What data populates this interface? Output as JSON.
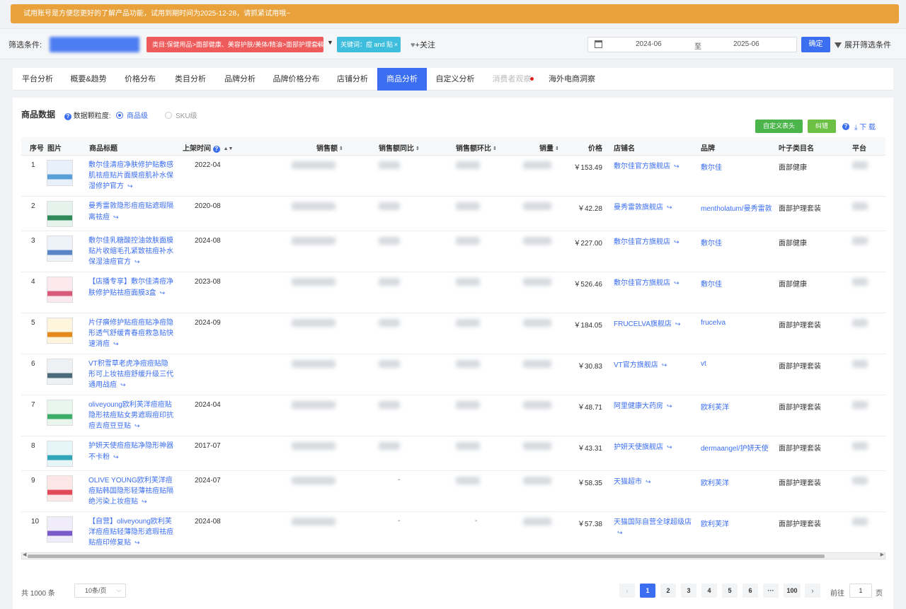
{
  "notice": "试用账号是方便您更好的了解产品功能，试用到期时间为2025-12-28，请抓紧试用哦~",
  "filter": {
    "label": "筛选条件:",
    "category_tag": "类目:保健用品>面部健康、美容护肤/美体/精油>面部护理套装",
    "keyword_tag": "关键词：痘 and 贴",
    "tag_close": "×",
    "follow": "+关注",
    "date_start": "2024-06",
    "date_to": "至",
    "date_end": "2025-06",
    "confirm": "确定",
    "expand": "展开筛选条件"
  },
  "tabs": [
    {
      "label": "平台分析",
      "state": "normal"
    },
    {
      "label": "概要&趋势",
      "state": "normal"
    },
    {
      "label": "价格分布",
      "state": "normal"
    },
    {
      "label": "类目分析",
      "state": "normal"
    },
    {
      "label": "品牌分析",
      "state": "normal"
    },
    {
      "label": "品牌价格分布",
      "state": "normal"
    },
    {
      "label": "店铺分析",
      "state": "normal"
    },
    {
      "label": "商品分析",
      "state": "active"
    },
    {
      "label": "自定义分析",
      "state": "normal"
    },
    {
      "label": "消费者观察",
      "state": "disabled"
    },
    {
      "label": "海外电商洞察",
      "state": "normal"
    }
  ],
  "panel": {
    "title": "商品数据",
    "granularity_label": "数据颗粒度:",
    "option_product": "商品级",
    "option_sku": "SKU级",
    "btn_custom_header": "自定义表头",
    "btn_fix": "纠错",
    "download": "下 载"
  },
  "table": {
    "headers": {
      "idx": "序号",
      "img": "图片",
      "title": "商品标题",
      "date": "上架时间",
      "sales": "销售额",
      "yoy": "销售额同比",
      "mom": "销售额环比",
      "volume": "销量",
      "price": "价格",
      "shop": "店铺名",
      "brand": "品牌",
      "category": "叶子类目名",
      "platform": "平台"
    },
    "rows": [
      {
        "idx": "1",
        "title": "敷尔佳清痘净肤修护贴敷感肌祛痘贴片面膜痘肌补水保湿修护官方",
        "date": "2022-04",
        "price": "￥153.49",
        "shop": "敷尔佳官方旗舰店",
        "brand": "敷尔佳",
        "category": "面部健康",
        "yoy": "",
        "mom": ""
      },
      {
        "idx": "2",
        "title": "曼秀雷敦隐形痘痘贴遮瑕隔离祛痘",
        "date": "2020-08",
        "price": "￥42.28",
        "shop": "曼秀雷敦旗舰店",
        "brand": "mentholatum/曼秀雷敦",
        "category": "面部护理套装",
        "yoy": "",
        "mom": ""
      },
      {
        "idx": "3",
        "title": "敷尔佳乳糖酸控油敛肤面膜贴片收缩毛孔紧致祛痘补水保湿油痘官方",
        "date": "2024-08",
        "price": "￥227.00",
        "shop": "敷尔佳官方旗舰店",
        "brand": "敷尔佳",
        "category": "面部健康",
        "yoy": "",
        "mom": ""
      },
      {
        "idx": "4",
        "title": "【店播专享】敷尔佳清痘净肤修护贴祛痘面膜3盒",
        "date": "2023-08",
        "price": "￥526.46",
        "shop": "敷尔佳官方旗舰店",
        "brand": "敷尔佳",
        "category": "面部健康",
        "yoy": "",
        "mom": ""
      },
      {
        "idx": "5",
        "title": "片仔癀修护贴痘痘贴净痘隐形透气舒缓青春痘救急贴快速消痘",
        "date": "2024-09",
        "price": "￥184.05",
        "shop": "FRUCELVA旗舰店",
        "brand": "frucelva",
        "category": "面部护理套装",
        "yoy": "",
        "mom": ""
      },
      {
        "idx": "6",
        "title": "VT积雪草老虎净痘痘贴隐形可上妆祛痘舒缓升级三代通用战痘",
        "date": "",
        "price": "￥30.83",
        "shop": "VT官方旗舰店",
        "brand": "vt",
        "category": "面部护理套装",
        "yoy": "",
        "mom": ""
      },
      {
        "idx": "7",
        "title": "oliveyoung欧利芙洋痘痘贴隐形祛痘贴女男遮瑕痘印抗痘去痘豆豆贴",
        "date": "2024-04",
        "price": "￥48.71",
        "shop": "阿里健康大药房",
        "brand": "欧利芙洋",
        "category": "面部护理套装",
        "yoy": "",
        "mom": ""
      },
      {
        "idx": "8",
        "title": "护妍天使痘痘贴净隐形神器不卡粉",
        "date": "2017-07",
        "price": "￥43.31",
        "shop": "护妍天使旗舰店",
        "brand": "dermaangel/护妍天使",
        "category": "面部护理套装",
        "yoy": "",
        "mom": ""
      },
      {
        "idx": "9",
        "title": "OLIVE YOUNG欧利芙洋痘痘贴韩国隐形轻薄祛痘贴隔绝污染上妆痘贴",
        "date": "2024-07",
        "price": "￥58.35",
        "shop": "天猫超市",
        "brand": "欧利芙洋",
        "category": "面部护理套装",
        "yoy": "-",
        "mom": ""
      },
      {
        "idx": "10",
        "title": "【自营】oliveyoung欧利芙洋痘痘贴轻薄隐形遮瑕祛痘贴痘印修复贴",
        "date": "2024-08",
        "price": "￥57.38",
        "shop": "天猫国际自营全球超级店",
        "brand": "欧利芙洋",
        "category": "面部护理套装",
        "yoy": "-",
        "mom": "-"
      }
    ]
  },
  "pagination": {
    "total": "共 1000 条",
    "page_size": "10条/页",
    "pages": [
      "1",
      "2",
      "3",
      "4",
      "5",
      "6",
      "···",
      "100"
    ],
    "current": "1",
    "goto_prefix": "前往",
    "goto_value": "1",
    "goto_suffix": "页"
  },
  "colors": {
    "accent": "#3b6ef0",
    "notice_bg": "#e9a23b",
    "category_tag": "#ef5a5a",
    "keyword_tag": "#3fbddc",
    "custom_btn": "#4bb54b",
    "fix_btn": "#6cc044"
  },
  "icons": {
    "link": "external-link-icon",
    "help": "question-circle-icon",
    "calendar": "calendar-icon",
    "filter": "funnel-icon",
    "follow": "heart-icon",
    "download": "download-icon"
  }
}
